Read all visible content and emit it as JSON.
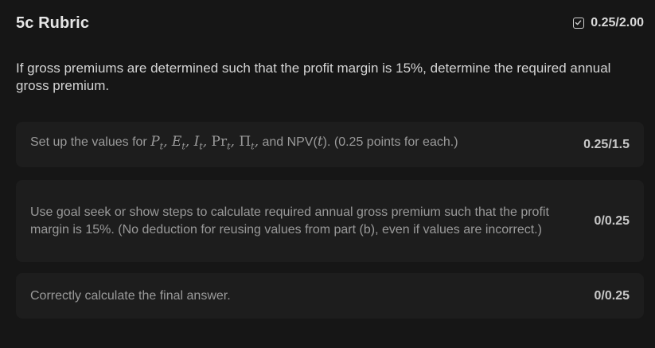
{
  "header": {
    "title": "5c Rubric",
    "total_score": "0.25/2.00",
    "check_icon": "checkbox-check-icon"
  },
  "prompt": "If gross premiums are determined such that the profit margin is 15%, determine the required annual gross premium.",
  "criteria": [
    {
      "text_before": "Set up the values for",
      "symbols": [
        "P",
        "E",
        "I",
        "Pr",
        "Π"
      ],
      "subscript": "t",
      "text_and": "and NPV(",
      "text_after": "). (0.25 points for each.)",
      "points": "0.25/1.5"
    },
    {
      "text": "Use goal seek or show steps to calculate required annual gross premium such that the profit margin is 15%. (No deduction for reusing values from part (b), even if values are incorrect.)",
      "points": "0/0.25"
    },
    {
      "text": "Correctly calculate the final answer.",
      "points": "0/0.25"
    }
  ],
  "colors": {
    "background": "#161616",
    "card": "#1d1d1d",
    "muted_text": "#9a9a9a"
  }
}
